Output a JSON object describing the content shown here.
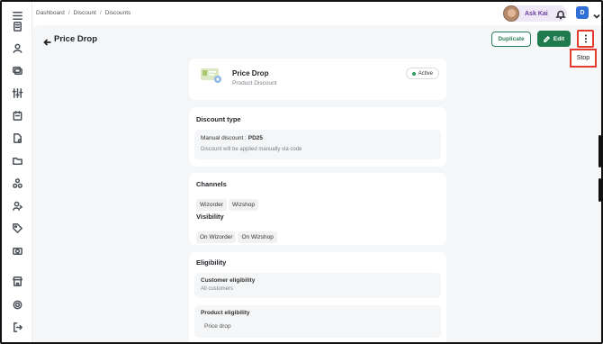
{
  "breadcrumb": [
    "Dashboard",
    "Discount",
    "Discounts"
  ],
  "header": {
    "ask_label": "Ask Kai",
    "user_initial": "D"
  },
  "page": {
    "title": "Price Drop"
  },
  "actions": {
    "duplicate_label": "Duplicate",
    "edit_label": "Edit",
    "menu_items": [
      "Stop"
    ]
  },
  "summary": {
    "name": "Price Drop",
    "type": "Product Discount",
    "status": "Active"
  },
  "discount_type": {
    "heading": "Discount type",
    "method_label": "Manual discount",
    "code": "PD25",
    "note": "Discount will be applied manually via code"
  },
  "channels": {
    "heading": "Channels",
    "items": [
      "Wizorder",
      "Wizshop"
    ]
  },
  "visibility": {
    "heading": "Visibility",
    "items": [
      "On Wizorder",
      "On Wizshop"
    ]
  },
  "eligibility": {
    "heading": "Eligibility",
    "customer_label": "Customer eligibility",
    "customer_value": "All customers",
    "product_label": "Product eligibility",
    "product_value": "Price drop"
  },
  "colors": {
    "primary": "#1f7a4d",
    "highlight": "#e23b30",
    "status_active": "#2e9d5f",
    "avatar_d": "#2f6fd6"
  },
  "icons": [
    "menu-icon",
    "clipboard-icon",
    "user-icon",
    "coins-icon",
    "sliders-icon",
    "calendar-icon",
    "document-icon",
    "folder-icon",
    "boxes-icon",
    "user-share-icon",
    "tag-icon",
    "camera-icon",
    "store-icon",
    "gear-icon",
    "logout-icon",
    "bell-icon",
    "chevron-down-icon",
    "arrow-left-icon",
    "pencil-icon",
    "more-vertical-icon"
  ]
}
